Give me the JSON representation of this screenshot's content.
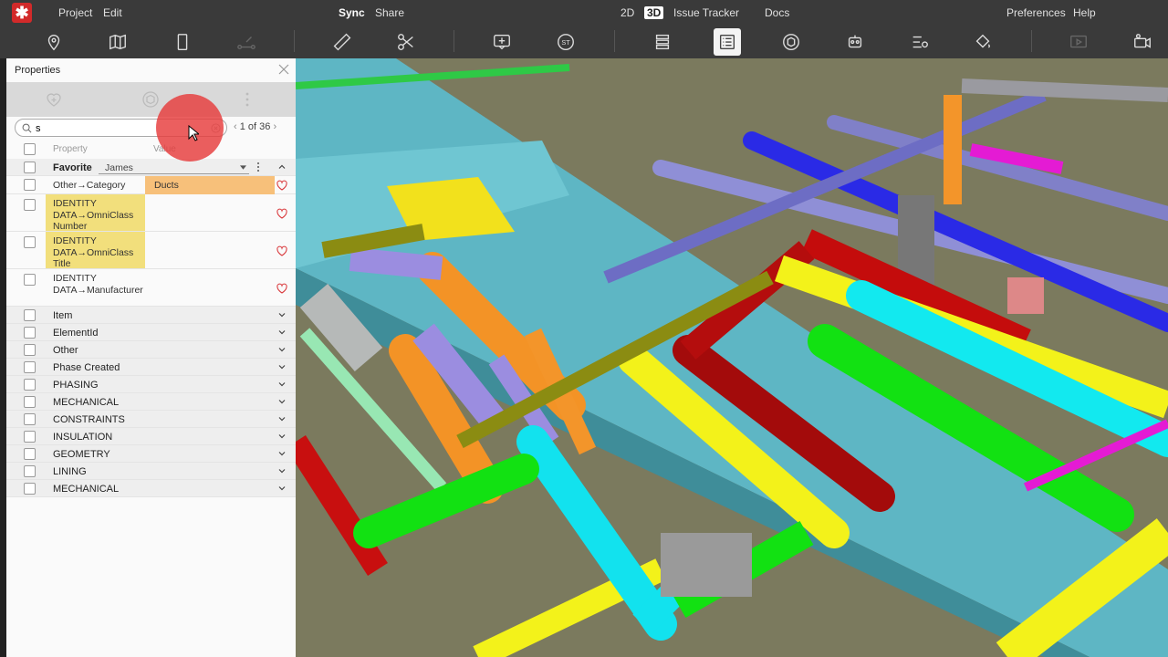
{
  "menu": {
    "project": "Project",
    "edit": "Edit",
    "sync": "Sync",
    "share": "Share",
    "mode_2d": "2D",
    "mode_3d": "3D",
    "issue_tracker": "Issue Tracker",
    "docs": "Docs",
    "preferences": "Preferences",
    "help": "Help"
  },
  "panel": {
    "title": "Properties",
    "search_value": "s",
    "pager": "1 of 36",
    "col_property": "Property",
    "col_value": "Value",
    "favorite": {
      "label": "Favorite",
      "user": "James"
    },
    "fav_rows": [
      {
        "property": "Other→Category",
        "value": "Ducts"
      },
      {
        "property": "IDENTITY DATA→OmniClass Number",
        "value": ""
      },
      {
        "property": "IDENTITY DATA→OmniClass Title",
        "value": ""
      },
      {
        "property": "IDENTITY DATA→Manufacturer",
        "value": ""
      }
    ],
    "groups": [
      "Item",
      "ElementId",
      "Other",
      "Phase Created",
      "PHASING",
      "MECHANICAL",
      "CONSTRAINTS",
      "INSULATION",
      "GEOMETRY",
      "LINING",
      "MECHANICAL"
    ]
  },
  "colors": {
    "highlight_yellow": "#f2df7c",
    "highlight_orange": "#f7c07a",
    "heart_red": "#d9393c",
    "viewport_bg": "#7b7a5e"
  }
}
